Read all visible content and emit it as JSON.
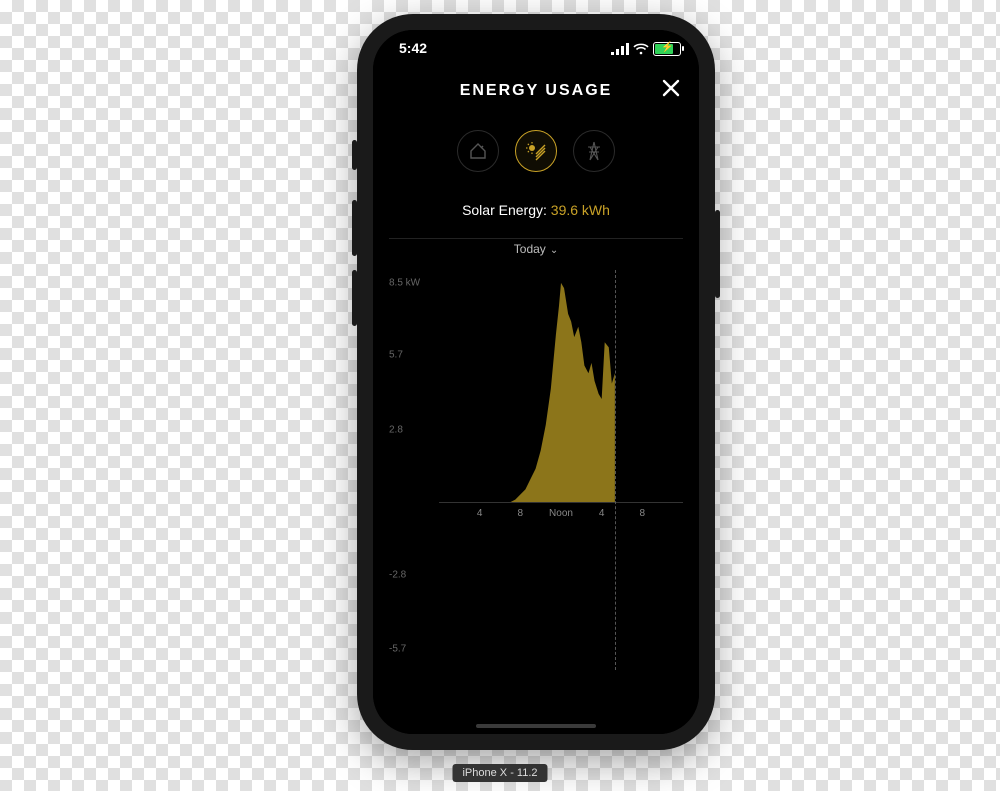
{
  "status": {
    "time": "5:42"
  },
  "header": {
    "title": "ENERGY USAGE"
  },
  "categories": {
    "items": [
      {
        "id": "home",
        "label": "Home usage"
      },
      {
        "id": "solar",
        "label": "Solar",
        "selected": true
      },
      {
        "id": "grid",
        "label": "Grid"
      }
    ]
  },
  "metric": {
    "label": "Solar Energy: ",
    "value": "39.6 kWh"
  },
  "range": {
    "selected": "Today"
  },
  "caption": "iPhone X - 11.2",
  "chart_data": {
    "type": "area",
    "title": "Solar Energy — Today",
    "xlabel": "",
    "ylabel": "kW",
    "ylim": [
      -6.5,
      9.0
    ],
    "x_ticks": [
      "4",
      "8",
      "Noon",
      "4",
      "8"
    ],
    "y_ticks": [
      8.5,
      5.7,
      2.8,
      -2.8,
      -5.7
    ],
    "y_tick_labels": [
      "8.5 kW",
      "5.7",
      "2.8",
      "-2.8",
      "-5.7"
    ],
    "now_x": 17.3,
    "series": [
      {
        "name": "Solar",
        "color": "#a58a1f",
        "x": [
          0,
          4,
          5,
          6,
          7,
          7.5,
          8,
          8.5,
          9,
          9.5,
          10,
          10.5,
          11,
          11.5,
          11.8,
          12,
          12.3,
          12.7,
          13,
          13.3,
          13.7,
          14,
          14.3,
          14.7,
          15,
          15.3,
          15.7,
          16,
          16.3,
          16.7,
          17,
          17.3
        ],
        "values": [
          0,
          0,
          0,
          0,
          0,
          0.1,
          0.3,
          0.5,
          0.9,
          1.3,
          2.0,
          3.0,
          4.4,
          6.5,
          7.6,
          8.5,
          8.3,
          7.3,
          7.0,
          6.4,
          6.8,
          6.2,
          5.3,
          5.0,
          5.4,
          4.7,
          4.2,
          4.0,
          6.2,
          6.0,
          4.6,
          5.0
        ]
      }
    ]
  }
}
